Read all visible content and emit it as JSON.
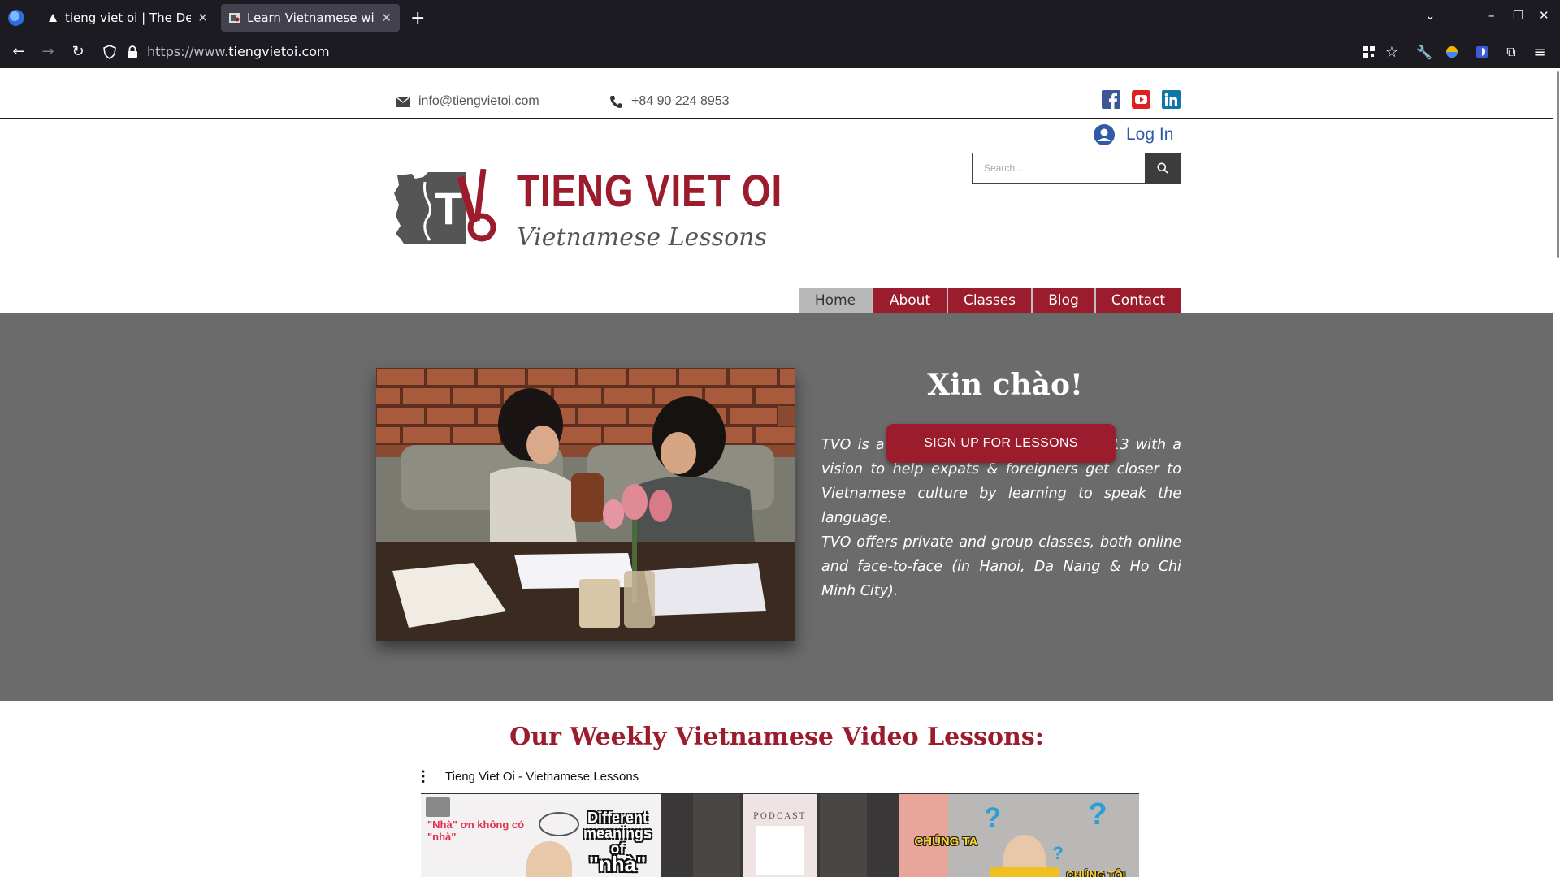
{
  "browser": {
    "tabs": [
      {
        "title": "tieng viet oi | The Deftai",
        "active": false
      },
      {
        "title": "Learn Vietnamese with",
        "active": true
      }
    ],
    "new_tab": "+",
    "url_proto": "https://www.",
    "url_host": "tiengvietoi.com"
  },
  "header": {
    "email": "info@tiengvietoi.com",
    "phone": "+84 90 224 8953",
    "login": "Log In",
    "search_placeholder": "Search..."
  },
  "logo": {
    "title": "TIENG VIET OI",
    "subtitle": "Vietnamese Lessons"
  },
  "menu": [
    "Home",
    "About",
    "Classes",
    "Blog",
    "Contact"
  ],
  "hero": {
    "title": "Xin chào!",
    "p1": "TVO is a teaching group founded in 2013 with a vision to help expats & foreigners get closer to Vietnamese culture by learning to speak the language.",
    "p2": "TVO offers private and group classes, both online and face-to-face (in Hanoi, Da Nang & Ho Chi Minh City).",
    "cta": "SIGN UP FOR LESSONS"
  },
  "videos": {
    "title": "Our Weekly Vietnamese Video Lessons:",
    "playlist": "Tieng Viet Oi - Vietnamese Lessons",
    "thumb1_text": [
      "Different",
      "meanings",
      "of",
      "\"nhà\""
    ],
    "thumb1_pink": "\"Nhà\" ơn không có \"nhà\"",
    "thumb2_text": "PODCAST",
    "thumb3_text": [
      "CHÚNG TA",
      "CHÚNG TÔI"
    ]
  },
  "colors": {
    "brand_red": "#9b1c2c",
    "hero_gray": "#6b6b6b",
    "chrome_dark": "#1c1b22"
  }
}
